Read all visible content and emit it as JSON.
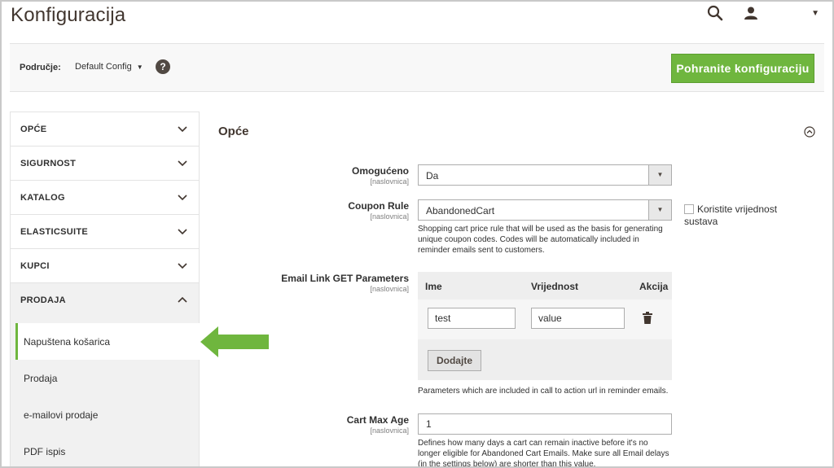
{
  "header": {
    "title": "Konfiguracija",
    "user_name": ""
  },
  "scope": {
    "label": "Područje:",
    "value": "Default Config",
    "help_icon": "question-icon",
    "save_label": "Pohranite konfiguraciju"
  },
  "sidebar": {
    "sections": [
      {
        "label": "OPĆE"
      },
      {
        "label": "SIGURNOST"
      },
      {
        "label": "KATALOG"
      },
      {
        "label": "ELASTICSUITE"
      },
      {
        "label": "KUPCI"
      },
      {
        "label": "PRODAJA"
      }
    ],
    "items": [
      {
        "label": "Napuštena košarica",
        "active": true
      },
      {
        "label": "Prodaja"
      },
      {
        "label": "e-mailovi prodaje"
      },
      {
        "label": "PDF ispis"
      }
    ]
  },
  "main": {
    "section_title": "Opće",
    "fields": {
      "enabled": {
        "label": "Omogućeno",
        "scope": "[naslovnica]",
        "value": "Da"
      },
      "coupon_rule": {
        "label": "Coupon Rule",
        "scope": "[naslovnica]",
        "value": "AbandonedCart",
        "use_system_label": "Koristite vrijednost sustava",
        "note": "Shopping cart price rule that will be used as the basis for generating unique coupon codes. Codes will be automatically included in reminder emails sent to customers."
      },
      "email_link": {
        "label": "Email Link GET Parameters",
        "scope": "[naslovnica]",
        "col_name": "Ime",
        "col_value": "Vrijednost",
        "col_action": "Akcija",
        "rows": [
          {
            "name": "test",
            "value": "value"
          }
        ],
        "add_label": "Dodajte",
        "note": "Parameters which are included in call to action url in reminder emails."
      },
      "cart_max_age": {
        "label": "Cart Max Age",
        "scope": "[naslovnica]",
        "value": "1",
        "note": "Defines how many days a cart can remain inactive before it's no longer eligible for Abandoned Cart Emails. Make sure all Email delays (in the settings below) are shorter than this value."
      }
    }
  },
  "colors": {
    "accent": "#6fb63e",
    "text": "#303030",
    "title": "#41362f"
  }
}
